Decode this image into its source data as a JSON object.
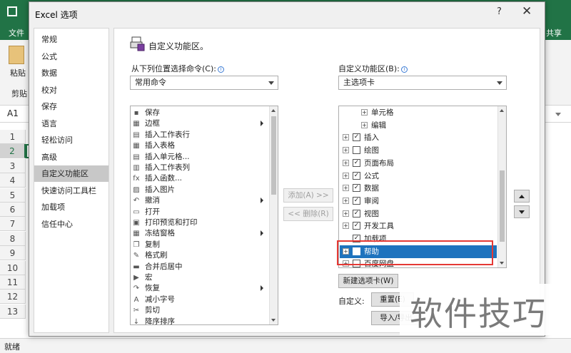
{
  "excel": {
    "ribbon_tab_file": "文件",
    "ribbon_tab_share": "共享",
    "paste_label": "粘贴",
    "clipboard_label": "剪贴",
    "name_box": "A1",
    "rows": [
      "1",
      "2",
      "3",
      "4",
      "5",
      "6",
      "7",
      "8",
      "9",
      "10",
      "11",
      "12",
      "13"
    ],
    "status": "就绪"
  },
  "dialog": {
    "title": "Excel 选项",
    "help": "?",
    "close": "✕",
    "nav": [
      {
        "label": "常规"
      },
      {
        "label": "公式"
      },
      {
        "label": "数据"
      },
      {
        "label": "校对"
      },
      {
        "label": "保存"
      },
      {
        "label": "语言"
      },
      {
        "label": "轻松访问"
      },
      {
        "label": "高级"
      },
      {
        "label": "自定义功能区",
        "active": true
      },
      {
        "label": "快速访问工具栏"
      },
      {
        "label": "加载项"
      },
      {
        "label": "信任中心"
      }
    ],
    "content": {
      "heading": "自定义功能区。",
      "left_label": "从下列位置选择命令(C):",
      "left_combo": "常用命令",
      "right_label": "自定义功能区(B):",
      "right_combo": "主选项卡",
      "commands": [
        {
          "icon": "save-icon",
          "glyph": "▪",
          "label": "保存"
        },
        {
          "icon": "border-icon",
          "glyph": "▦",
          "label": "边框",
          "submenu": true
        },
        {
          "icon": "insert-row-icon",
          "glyph": "▤",
          "label": "插入工作表行"
        },
        {
          "icon": "insert-table-icon",
          "glyph": "▦",
          "label": "插入表格"
        },
        {
          "icon": "insert-cell-icon",
          "glyph": "▤",
          "label": "插入单元格..."
        },
        {
          "icon": "insert-column-icon",
          "glyph": "▥",
          "label": "插入工作表列"
        },
        {
          "icon": "function-icon",
          "glyph": "fx",
          "label": "插入函数..."
        },
        {
          "icon": "picture-icon",
          "glyph": "▨",
          "label": "插入图片"
        },
        {
          "icon": "undo-icon",
          "glyph": "↶",
          "label": "撤消",
          "submenu": true
        },
        {
          "icon": "open-icon",
          "glyph": "▭",
          "label": "打开"
        },
        {
          "icon": "print-preview-icon",
          "glyph": "▣",
          "label": "打印预览和打印"
        },
        {
          "icon": "freeze-panes-icon",
          "glyph": "▦",
          "label": "冻结窗格",
          "submenu": true
        },
        {
          "icon": "copy-icon",
          "glyph": "❐",
          "label": "复制"
        },
        {
          "icon": "format-painter-icon",
          "glyph": "✎",
          "label": "格式刷"
        },
        {
          "icon": "merge-center-icon",
          "glyph": "▬",
          "label": "合并后居中"
        },
        {
          "icon": "macro-icon",
          "glyph": "▶",
          "label": "宏"
        },
        {
          "icon": "redo-icon",
          "glyph": "↷",
          "label": "恢复",
          "submenu": true
        },
        {
          "icon": "decrease-font-icon",
          "glyph": "A",
          "label": "减小字号"
        },
        {
          "icon": "cut-icon",
          "glyph": "✂",
          "label": "剪切"
        },
        {
          "icon": "sort-descending-icon",
          "glyph": "↓",
          "label": "降序排序"
        }
      ],
      "add_button": "添加(A) >>",
      "remove_button": "<< 删除(R)",
      "tabs_tree": [
        {
          "label": "单元格",
          "expander": "+",
          "level": 2,
          "checkbox": false
        },
        {
          "label": "编辑",
          "expander": "+",
          "level": 2,
          "checkbox": false
        },
        {
          "label": "插入",
          "expander": "+",
          "level": 1,
          "checkbox": true,
          "checked": true
        },
        {
          "label": "绘图",
          "expander": "+",
          "level": 1,
          "checkbox": true,
          "checked": false
        },
        {
          "label": "页面布局",
          "expander": "+",
          "level": 1,
          "checkbox": true,
          "checked": true
        },
        {
          "label": "公式",
          "expander": "+",
          "level": 1,
          "checkbox": true,
          "checked": true
        },
        {
          "label": "数据",
          "expander": "+",
          "level": 1,
          "checkbox": true,
          "checked": true
        },
        {
          "label": "审阅",
          "expander": "+",
          "level": 1,
          "checkbox": true,
          "checked": true
        },
        {
          "label": "视图",
          "expander": "+",
          "level": 1,
          "checkbox": true,
          "checked": true
        },
        {
          "label": "开发工具",
          "expander": "+",
          "level": 1,
          "checkbox": true,
          "checked": true
        },
        {
          "label": "加载项",
          "expander": "",
          "level": 1,
          "checkbox": true,
          "checked": true
        },
        {
          "label": "帮助",
          "expander": "+",
          "level": 1,
          "checkbox": true,
          "checked": false,
          "selected": true
        },
        {
          "label": "百度网盘",
          "expander": "+",
          "level": 1,
          "checkbox": true,
          "checked": false
        }
      ],
      "new_tab_button": "新建选项卡(W)",
      "customize_label": "自定义:",
      "reset_button": "重置(E)",
      "import_export_button": "导入/导出"
    }
  },
  "watermark": "软件技巧",
  "colors": {
    "excel_green": "#217346",
    "selection_blue": "#1e73be",
    "highlight_red": "#e53935"
  }
}
